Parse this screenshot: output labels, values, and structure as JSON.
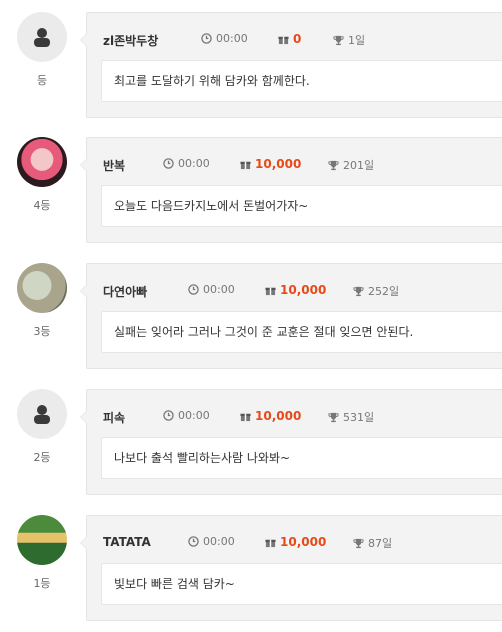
{
  "entries": [
    {
      "rank": "등",
      "avatar": "default-user",
      "name": "zl존박두창",
      "time": "00:00",
      "points": "0",
      "days": "1일",
      "message": "최고를 도달하기 위해 담카와 함께한다."
    },
    {
      "rank": "4등",
      "avatar": "photo",
      "name": "반복",
      "time": "00:00",
      "points": "10,000",
      "days": "201일",
      "message": "오늘도 다음드카지노에서 돈벌어가자~"
    },
    {
      "rank": "3등",
      "avatar": "photo",
      "name": "다연아빠",
      "time": "00:00",
      "points": "10,000",
      "days": "252일",
      "message": "실패는 잊어라 그러나 그것이 준 교훈은 절대 잊으면 안된다."
    },
    {
      "rank": "2등",
      "avatar": "default-user",
      "name": "피속",
      "time": "00:00",
      "points": "10,000",
      "days": "531일",
      "message": "나보다 출석 빨리하는사람 나와봐~"
    },
    {
      "rank": "1등",
      "avatar": "photo",
      "name": "TATATA",
      "time": "00:00",
      "points": "10,000",
      "days": "87일",
      "message": "빛보다 빠른 검색 담카~"
    }
  ],
  "colors": {
    "points": "#e64a19",
    "bubble": "#f3f3f3",
    "border": "#e4e4e4"
  },
  "icons": {
    "time": "clock-icon",
    "points": "gift-icon",
    "days": "trophy-icon",
    "avatar_default": "user-icon"
  }
}
